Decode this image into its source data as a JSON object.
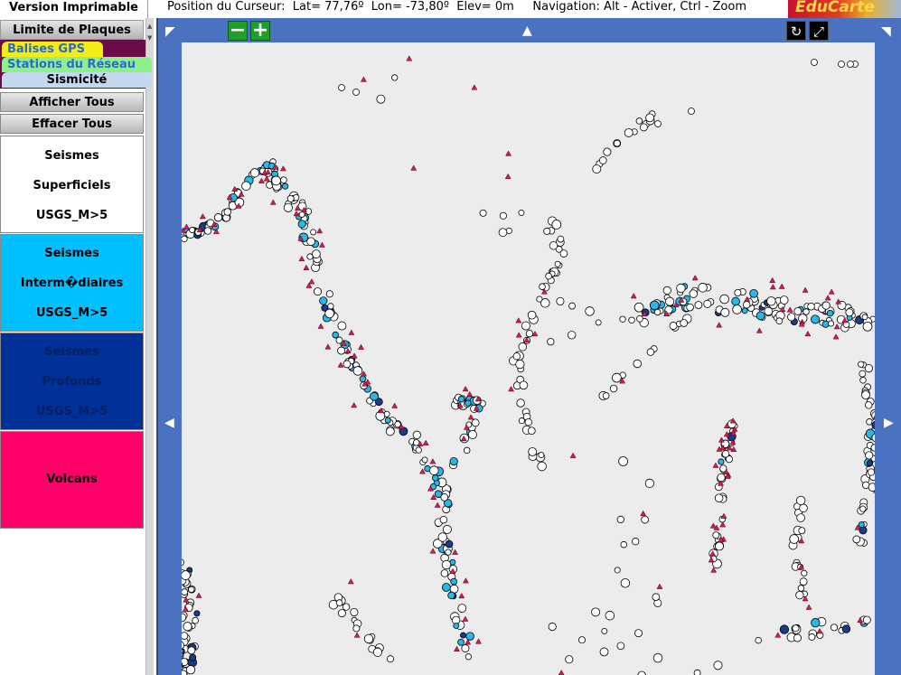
{
  "header": {
    "print_label": "Version Imprimable",
    "cursor_position": "Position du Curseur:  Lat= 77,76º  Lon= -73,80º  Elev= 0m",
    "navigation_hint": "Navigation: Alt - Activer, Ctrl - Zoom",
    "logo_text": "EduCarte"
  },
  "sidebar": {
    "plates_label": "Limite de Plaques",
    "tabs": {
      "gps": "Balises GPS",
      "stations": "Stations du Réseau",
      "seismicity": "Sismicité"
    },
    "show_all_label": "Afficher Tous",
    "clear_all_label": "Effacer Tous",
    "legend": {
      "shallow": [
        "Seismes",
        "Superficiels",
        "USGS_M>5"
      ],
      "intermediate": [
        "Seismes",
        "Interm�diaires",
        "USGS_M>5"
      ],
      "deep": [
        "Seismes",
        "Profonds",
        "USGS_M>5"
      ],
      "volcanoes": "Volcans"
    }
  },
  "map": {
    "zoom_out_icon": "minus-icon",
    "zoom_in_icon": "plus-icon",
    "tool_icons": [
      "rotate-icon",
      "fullscreen-icon"
    ],
    "colors": {
      "shallow": "#ffffff",
      "intermediate": "#29b6e8",
      "deep": "#1a3a8a",
      "volcano": "#d81858",
      "frame": "#4a72c0",
      "background": "#ececec"
    }
  }
}
